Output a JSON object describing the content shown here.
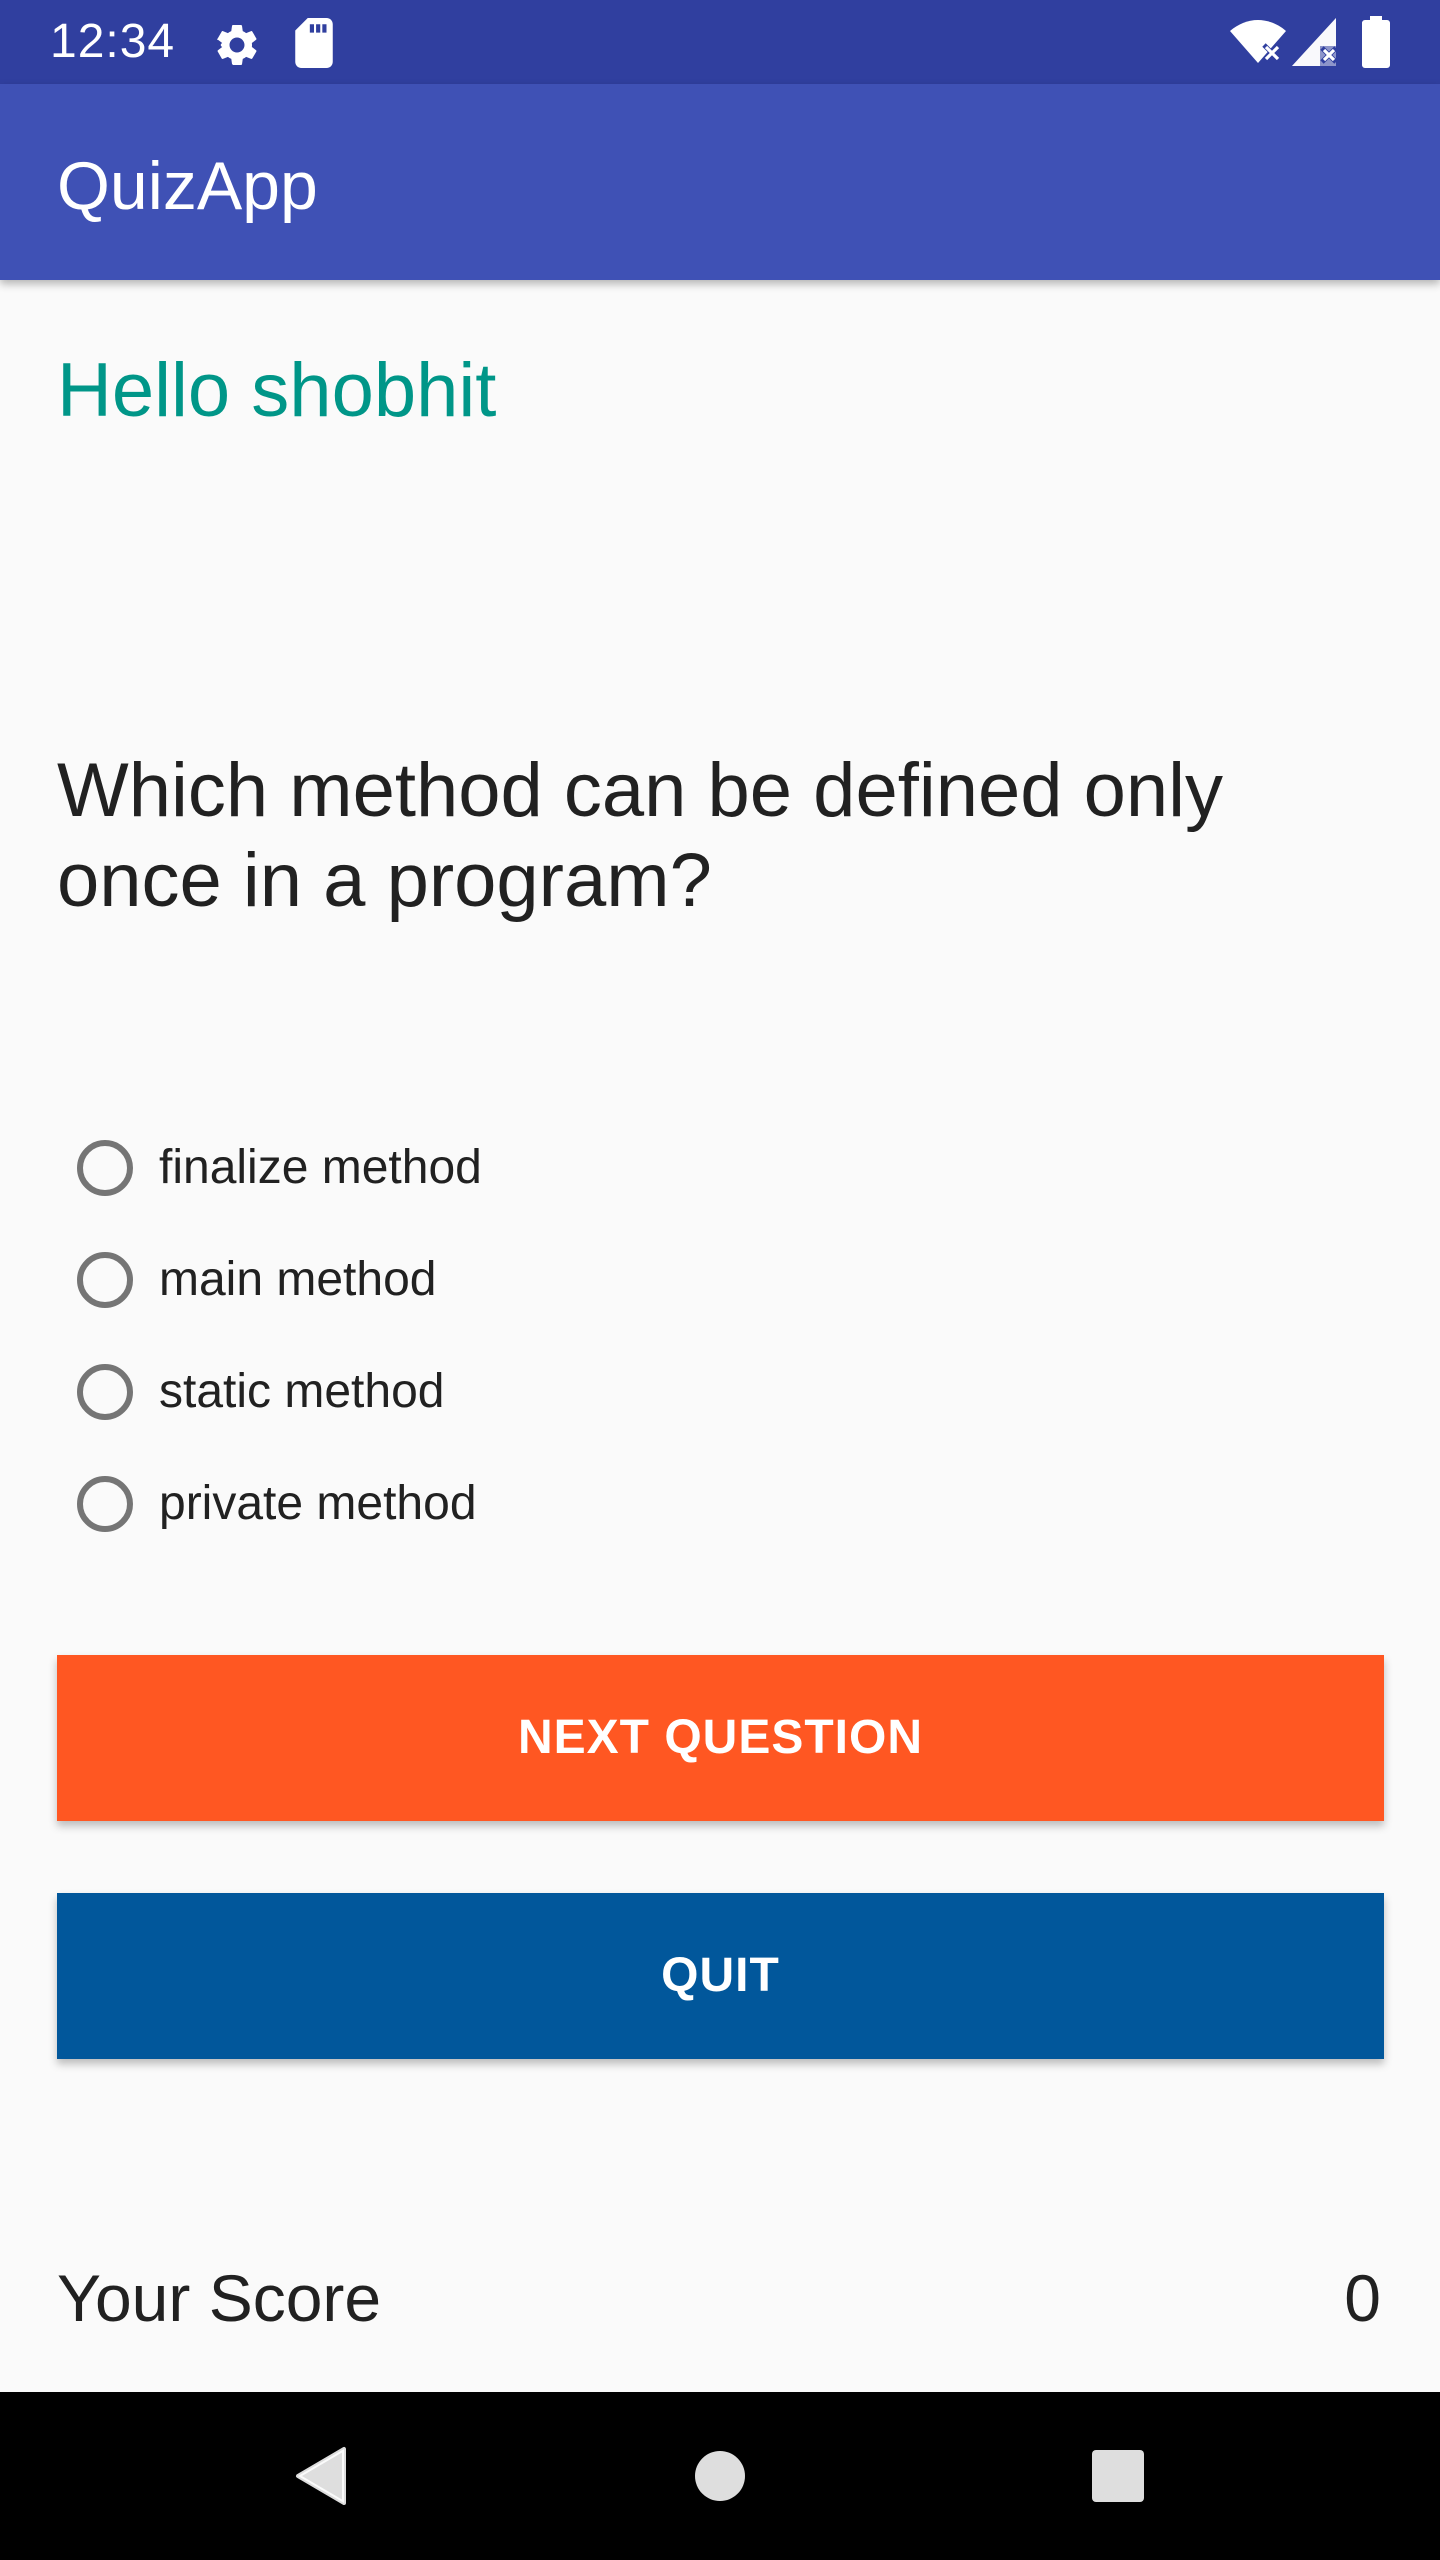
{
  "status_bar": {
    "time": "12:34",
    "icons": [
      "settings-icon",
      "sd-card-icon",
      "wifi-no-data-icon",
      "signal-no-data-icon",
      "battery-full-icon"
    ],
    "color": "#303F9F"
  },
  "app_bar": {
    "title": "QuizApp",
    "color": "#3F51B5"
  },
  "greeting": "Hello shobhit",
  "question": "Which method can be defined only once in a program?",
  "options": [
    {
      "label": "finalize method",
      "selected": false
    },
    {
      "label": "main method",
      "selected": false
    },
    {
      "label": "static method",
      "selected": false
    },
    {
      "label": "private method",
      "selected": false
    }
  ],
  "buttons": {
    "next_label": "NEXT QUESTION",
    "next_color": "#FF5722",
    "quit_label": "QUIT",
    "quit_color": "#01579B"
  },
  "score": {
    "label": "Your Score",
    "value": "0"
  },
  "nav_bar": {
    "icons": [
      "back-icon",
      "home-icon",
      "recents-icon"
    ]
  },
  "colors": {
    "accent": "#009688",
    "background": "#FAFAFA"
  }
}
